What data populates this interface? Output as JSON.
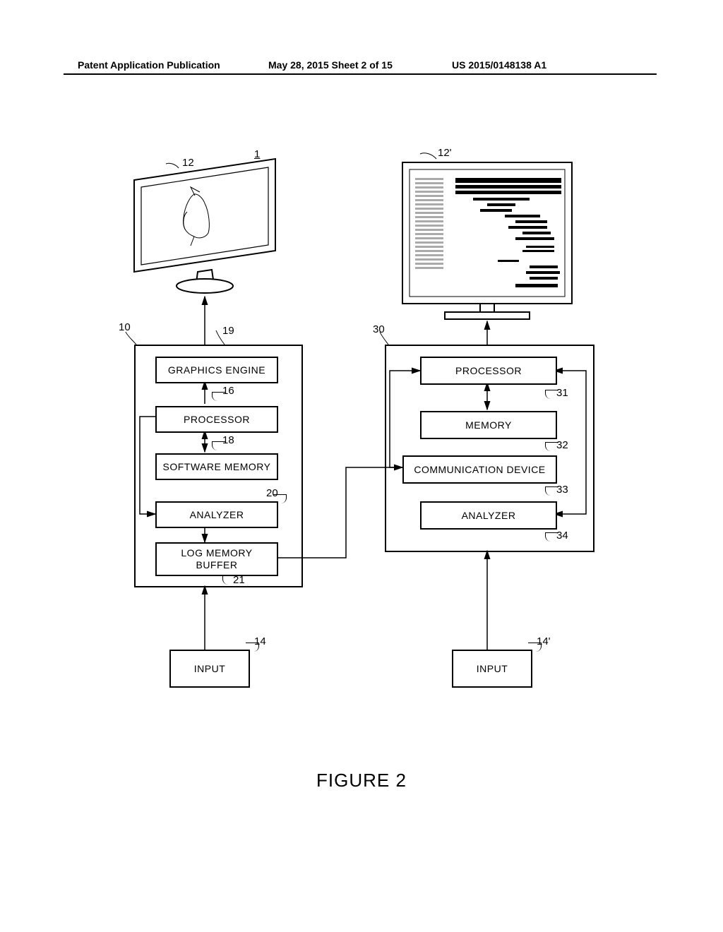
{
  "header": {
    "left": "Patent Application Publication",
    "center": "May 28, 2015  Sheet 2 of 15",
    "right": "US 2015/0148138 A1"
  },
  "figure_title": "FIGURE 2",
  "refs": {
    "r1": "1",
    "r12": "12",
    "r12p": "12'",
    "r10": "10",
    "r19": "19",
    "r16": "16",
    "r18": "18",
    "r20": "20",
    "r21": "21",
    "r14": "14",
    "r30": "30",
    "r31": "31",
    "r32": "32",
    "r33": "33",
    "r34": "34",
    "r14p": "14'"
  },
  "left_device": {
    "graphics_engine": "GRAPHICS ENGINE",
    "processor": "PROCESSOR",
    "software_memory": "SOFTWARE MEMORY",
    "analyzer": "ANALYZER",
    "log_buffer_line1": "LOG MEMORY",
    "log_buffer_line2": "BUFFER",
    "input": "INPUT"
  },
  "right_device": {
    "processor": "PROCESSOR",
    "memory": "MEMORY",
    "comm_device": "COMMUNICATION DEVICE",
    "analyzer": "ANALYZER",
    "input": "INPUT"
  }
}
